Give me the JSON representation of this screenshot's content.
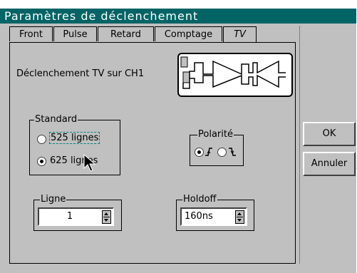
{
  "window": {
    "title": "Paramètres de déclenchement"
  },
  "tabs": [
    {
      "label": "Front",
      "active": false
    },
    {
      "label": "Pulse",
      "active": false
    },
    {
      "label": "Retard",
      "active": false
    },
    {
      "label": "Comptage",
      "active": false
    },
    {
      "label": "TV",
      "active": true
    }
  ],
  "trigger": {
    "label": "Déclenchement TV sur CH1"
  },
  "standard": {
    "legend": "Standard",
    "options": [
      {
        "label": "525 lignes",
        "selected": false,
        "focused": true
      },
      {
        "label": "625 lignes",
        "selected": true,
        "focused": false
      }
    ]
  },
  "polarity": {
    "legend": "Polarité",
    "positive_selected": true
  },
  "line": {
    "legend": "Ligne",
    "value": "1"
  },
  "holdoff": {
    "legend": "Holdoff",
    "value": "160ns"
  },
  "buttons": {
    "ok": "OK",
    "cancel": "Annuler"
  },
  "colors": {
    "titlebar": "#006464",
    "face": "#c0c0c0"
  }
}
